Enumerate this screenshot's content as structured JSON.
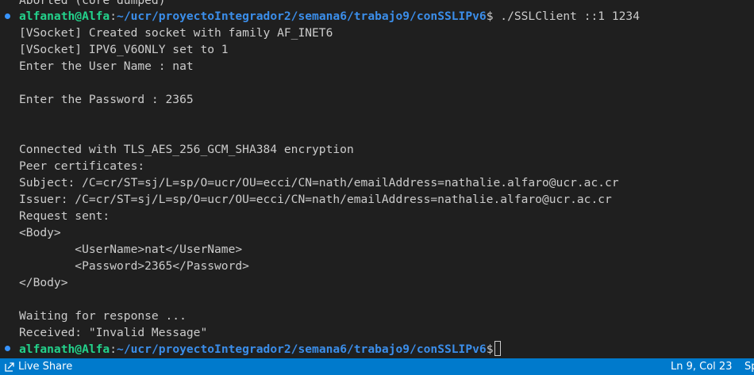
{
  "terminal": {
    "line0": "Aborted (core dumped)",
    "prompt1": {
      "user": "alfanath@Alfa",
      "sep": ":",
      "path": "~/ucr/proyectoIntegrador2/semana6/trabajo9/conSSLIPv6",
      "symbol": "$",
      "command": " ./SSLClient ::1 1234"
    },
    "output": [
      "[VSocket] Created socket with family AF_INET6",
      "[VSocket] IPV6_V6ONLY set to 1",
      "Enter the User Name : nat",
      "",
      "Enter the Password : 2365",
      "",
      "",
      "Connected with TLS_AES_256_GCM_SHA384 encryption",
      "Peer certificates:",
      "Subject: /C=cr/ST=sj/L=sp/O=ucr/OU=ecci/CN=nath/emailAddress=nathalie.alfaro@ucr.ac.cr",
      "Issuer: /C=cr/ST=sj/L=sp/O=ucr/OU=ecci/CN=nath/emailAddress=nathalie.alfaro@ucr.ac.cr",
      "Request sent:",
      "<Body>",
      "        <UserName>nat</UserName>",
      "        <Password>2365</Password>",
      "</Body>",
      "",
      "Waiting for response ...",
      "Received: \"Invalid Message\""
    ],
    "prompt2": {
      "user": "alfanath@Alfa",
      "sep": ":",
      "path": "~/ucr/proyectoIntegrador2/semana6/trabajo9/conSSLIPv6",
      "symbol": "$"
    }
  },
  "statusbar": {
    "live_share": "Live Share",
    "cursor_position": "Ln 9, Col 23",
    "spaces": "Sp"
  },
  "colors": {
    "background": "#1f1f1f",
    "text": "#cccccc",
    "prompt_user": "#23d18b",
    "prompt_path": "#3b8eea",
    "statusbar": "#007acc",
    "decoration": "#3794ff"
  },
  "icons": {
    "live_share": "live-share-icon",
    "command_decoration": "command-decoration-icon"
  }
}
